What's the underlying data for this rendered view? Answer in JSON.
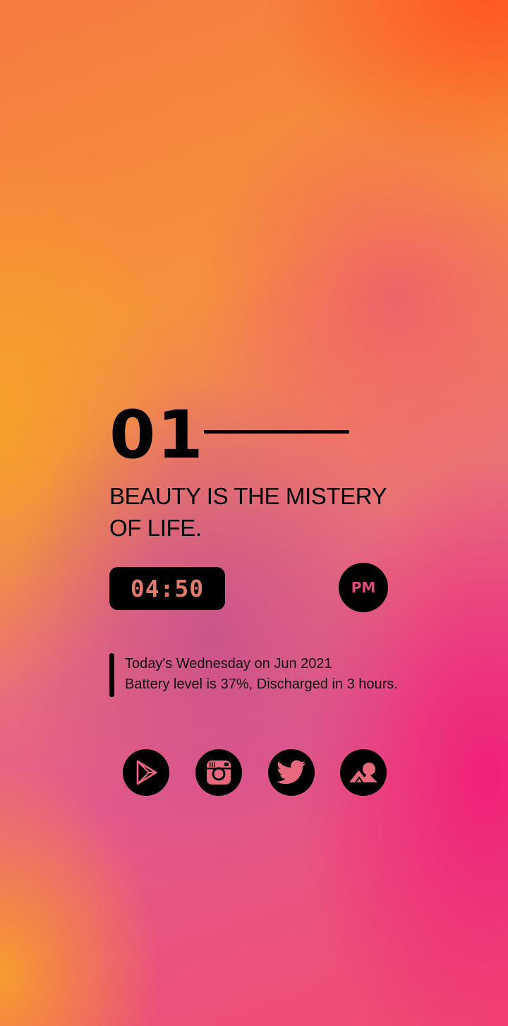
{
  "widget": {
    "number": "01",
    "quote": "BEAUTY IS THE MISTERY OF LIFE.",
    "time": "04:50",
    "meridiem": "PM",
    "info_line_1": "Today's Wednesday on Jun 2021",
    "info_line_2": "Battery level is 37%, Discharged in 3 hours."
  },
  "shortcuts": [
    {
      "icon": "play-store-icon"
    },
    {
      "icon": "instagram-icon"
    },
    {
      "icon": "twitter-icon"
    },
    {
      "icon": "gallery-icon"
    }
  ],
  "colors": {
    "time_text": "#e07b6b",
    "meridiem_text": "#e14a7c",
    "icon_fg": "#e8697e",
    "widget_dark": "#000000"
  }
}
